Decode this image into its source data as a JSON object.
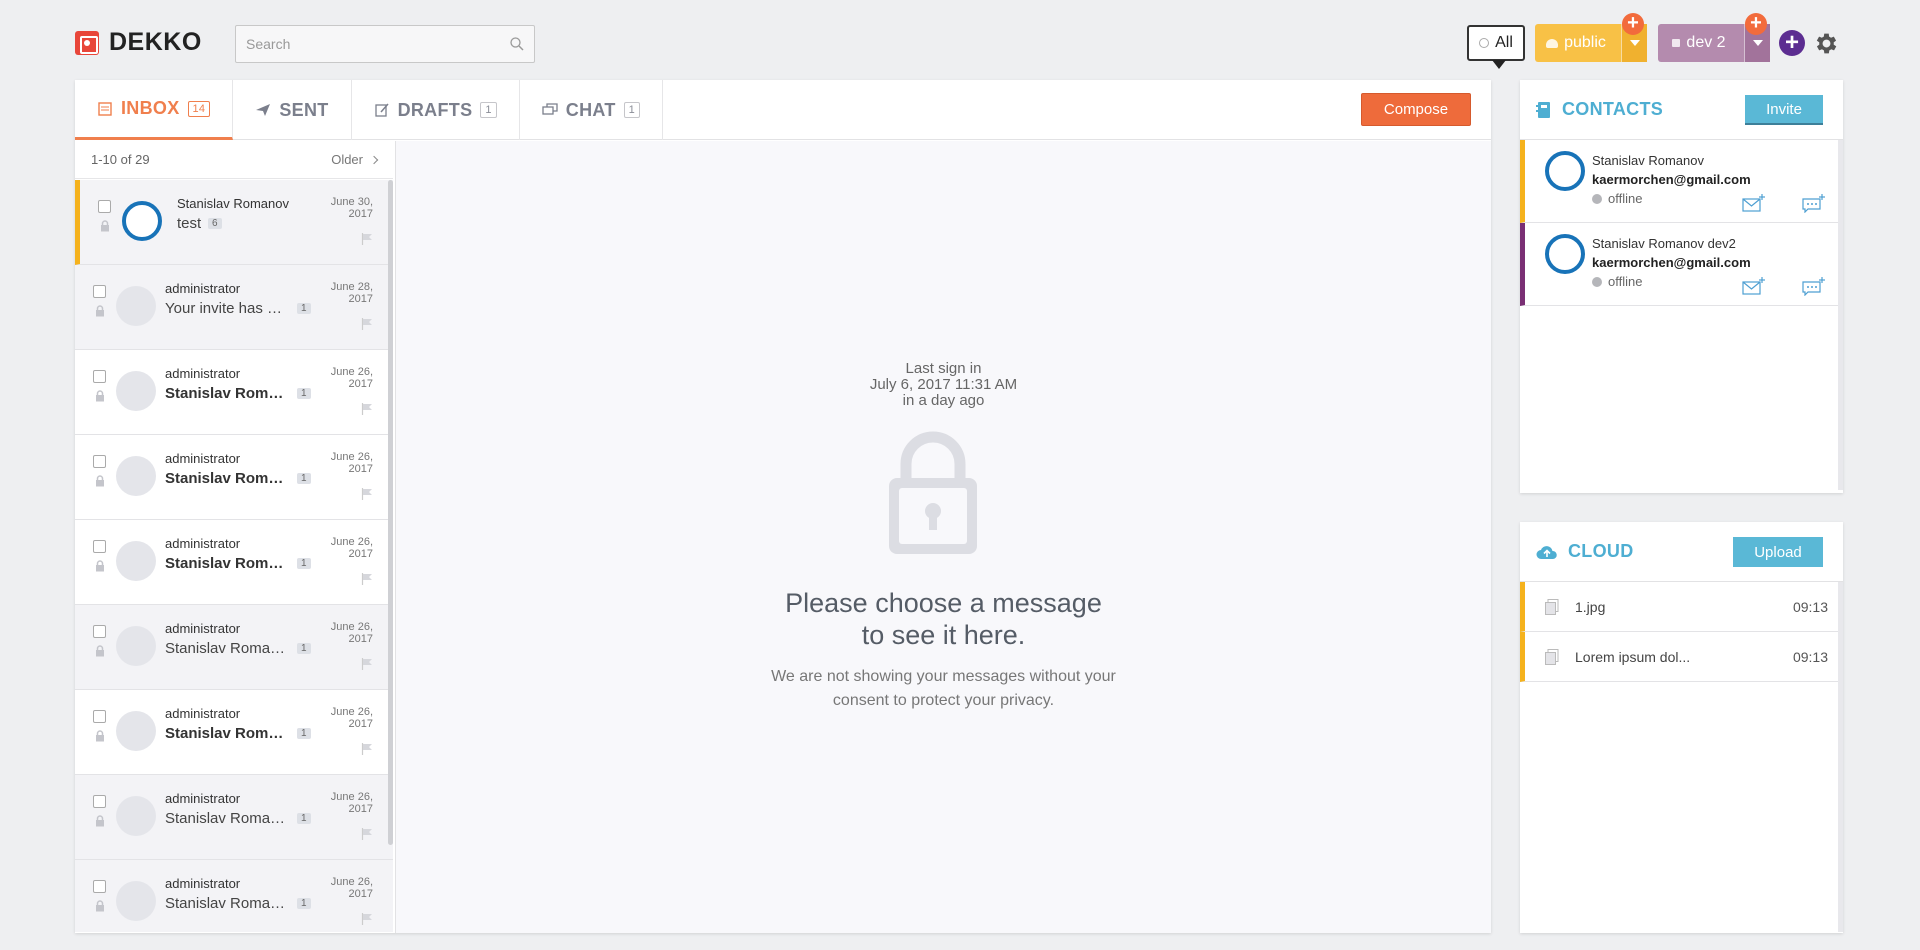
{
  "header": {
    "logo_text": "DEKKO",
    "search_placeholder": "Search",
    "filter_all": "All",
    "spaces": [
      {
        "label": "public",
        "color": "#f8c146"
      },
      {
        "label": "dev 2",
        "color": "#b48bae"
      }
    ]
  },
  "tabs": [
    {
      "label": "INBOX",
      "count": "14",
      "icon": "inbox-icon"
    },
    {
      "label": "SENT",
      "icon": "paper-plane-icon"
    },
    {
      "label": "DRAFTS",
      "count": "1",
      "icon": "draft-icon"
    },
    {
      "label": "CHAT",
      "count": "1",
      "icon": "chat-icon"
    }
  ],
  "compose_label": "Compose",
  "list": {
    "range": "1-10 of 29",
    "older": "Older",
    "messages": [
      {
        "sender": "Stanislav Romanov",
        "subject": "test",
        "count": "6",
        "date": "June 30, 2017",
        "avatar": "power",
        "bold": false
      },
      {
        "sender": "administrator",
        "subject": "Your invite has been sent",
        "count": "1",
        "date": "June 28, 2017",
        "avatar": "default",
        "bold": false
      },
      {
        "sender": "administrator",
        "subject": "Stanislav Romanov",
        "count": "1",
        "date": "June 26, 2017",
        "avatar": "default",
        "bold": true
      },
      {
        "sender": "administrator",
        "subject": "Stanislav Romanov",
        "count": "1",
        "date": "June 26, 2017",
        "avatar": "default",
        "bold": true
      },
      {
        "sender": "administrator",
        "subject": "Stanislav Romanov",
        "count": "1",
        "date": "June 26, 2017",
        "avatar": "default",
        "bold": true
      },
      {
        "sender": "administrator",
        "subject": "Stanislav Romanov",
        "count": "1",
        "date": "June 26, 2017",
        "avatar": "default",
        "bold": false
      },
      {
        "sender": "administrator",
        "subject": "Stanislav Romanov",
        "count": "1",
        "date": "June 26, 2017",
        "avatar": "default",
        "bold": true
      },
      {
        "sender": "administrator",
        "subject": "Stanislav Romanov",
        "count": "1",
        "date": "June 26, 2017",
        "avatar": "default",
        "bold": false
      },
      {
        "sender": "administrator",
        "subject": "Stanislav Romanov",
        "count": "1",
        "date": "June 26, 2017",
        "avatar": "default",
        "bold": false
      }
    ]
  },
  "reading": {
    "last_sign_label": "Last sign in",
    "last_sign_date": "July 6, 2017 11:31 AM",
    "last_sign_relative": "in a day ago",
    "choose_line1": "Please choose a message",
    "choose_line2": "to see it here.",
    "privacy_line1": "We are not showing your messages without your",
    "privacy_line2": "consent to protect your privacy."
  },
  "contacts": {
    "title": "CONTACTS",
    "invite_label": "Invite",
    "items": [
      {
        "name": "Stanislav Romanov",
        "email": "kaermorchen@gmail.com",
        "status": "offline"
      },
      {
        "name": "Stanislav Romanov dev2",
        "email": "kaermorchen@gmail.com",
        "status": "offline"
      }
    ]
  },
  "cloud": {
    "title": "CLOUD",
    "upload_label": "Upload",
    "files": [
      {
        "name": "1.jpg",
        "time": "09:13"
      },
      {
        "name": "Lorem ipsum dol...",
        "time": "09:13"
      }
    ]
  }
}
